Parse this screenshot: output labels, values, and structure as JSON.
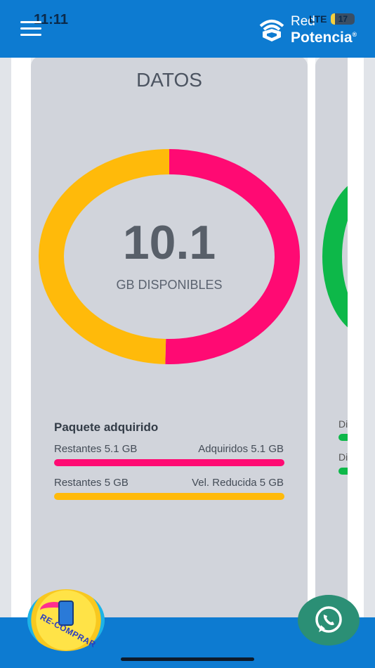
{
  "status_bar": {
    "time": "11:11",
    "network": "LTE",
    "battery": "17",
    "battery_level": 0.17
  },
  "header": {
    "brand_line1": "Red",
    "brand_line2": "Potencia",
    "brand_mark": "®"
  },
  "card": {
    "title": "DATOS",
    "value": "10.1",
    "value_label": "GB DISPONIBLES",
    "donut": {
      "segments": [
        {
          "value": 5.1,
          "color": "#ff0a73"
        },
        {
          "value": 5.0,
          "color": "#ffba0a"
        }
      ]
    },
    "package": {
      "title": "Paquete adquirido",
      "rows": [
        {
          "left": "Restantes 5.1 GB",
          "right": "Adquiridos 5.1 GB",
          "color": "#ff0a73",
          "fill": 1.0
        },
        {
          "left": "Restantes 5 GB",
          "right": "Vel. Reducida 5 GB",
          "color": "#ffba0a",
          "fill": 1.0
        }
      ]
    }
  },
  "card2": {
    "label1": "Di",
    "label2": "Di",
    "color": "#0db849"
  },
  "buttons": {
    "recompra": "RE-COMPRAR"
  },
  "icons": {
    "menu": "menu-icon",
    "brand": "wifi-logo-icon",
    "whatsapp": "whatsapp-icon"
  }
}
